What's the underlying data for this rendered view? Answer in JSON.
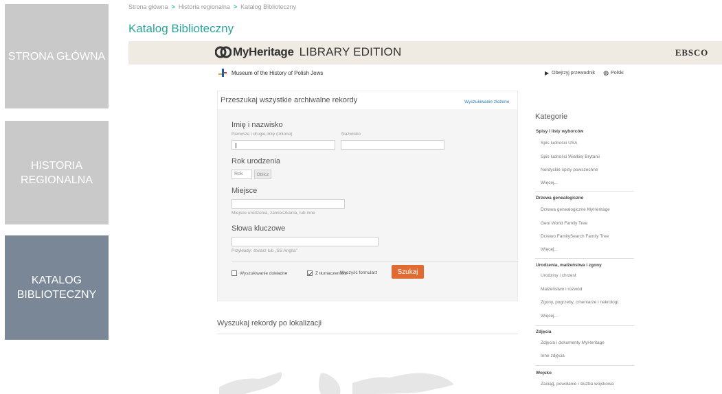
{
  "nav": {
    "tiles": [
      {
        "label": "STRONA GŁÓWNA"
      },
      {
        "label": "HISTORIA REGIONALNA"
      },
      {
        "label": "KATALOG BIBLIOTECZNY"
      }
    ],
    "colors": {
      "inactive": "#c9c9c9",
      "active": "#7a8797"
    }
  },
  "breadcrumb": {
    "items": [
      "Strona główna",
      "Historia regionalna",
      "Katalog Biblioteczny"
    ],
    "separator": ">"
  },
  "page_title": "Katalog Biblioteczny",
  "frame": {
    "brand": "MyHeritage",
    "edition": "LIBRARY EDITION",
    "partner": "EBSCO",
    "institution": "Museum of the History of Polish Jews",
    "guide_link": "Obejrzyj przewodnik",
    "language": "Polski",
    "icons": {
      "guide": "play-icon",
      "language": "globe-icon",
      "logo": "myheritage-logo-icon"
    }
  },
  "search": {
    "title": "Przeszukaj wszystkie archiwalne rekordy",
    "advanced_link": "Wyszukiwanie złożone",
    "name_section": "Imię i nazwisko",
    "first_name_label": "Pierwsze i drugie imię (imiona)",
    "last_name_label": "Nazwisko",
    "first_name_value": "",
    "last_name_value": "",
    "birth_section": "Rok urodzenia",
    "year_placeholder": "Rok",
    "calc_button": "Oblicz",
    "place_section": "Miejsce",
    "place_hint": "Miejsce urodzenia, zamieszkania, lub inne",
    "keywords_section": "Słowa kluczowe",
    "keywords_hint": "Przykłady: stolarz lub „SS Anglia”",
    "exact_label": "Wyszukiwanie dokładne",
    "exact_checked": false,
    "translation_label": "Z tłumaczeniem",
    "translation_checked": true,
    "clear_link": "Wyczyść formularz",
    "submit_button": "Szukaj",
    "accent_color": "#e06b32"
  },
  "location": {
    "title": "Wyszukaj rekordy po lokalizacji"
  },
  "categories": {
    "title": "Kategorie",
    "groups": [
      {
        "heading": "Spisy i listy wyborców",
        "items": [
          "Spis ludności USA",
          "Spis ludności Wielkiej Brytanii",
          "Nordyckie spisy powszechne",
          "Więcej..."
        ]
      },
      {
        "heading": "Drzewa genealogiczne",
        "items": [
          "Drzewa genealogiczne MyHeritage",
          "Geni World Family Tree",
          "Drzewo FamilySearch Family Tree",
          "Więcej..."
        ]
      },
      {
        "heading": "Urodzenia, małżeństwa i zgony",
        "items": [
          "Urodziny i chrzest",
          "Małżeństwo i rozwód",
          "Zgony, pogrzeby, cmentarze i nekrologi",
          "Więcej..."
        ]
      },
      {
        "heading": "Zdjęcia",
        "items": [
          "Zdjęcia i dokumenty MyHeritage",
          "Inne zdjęcia"
        ]
      },
      {
        "heading": "Wojsko",
        "items": [
          "Zaciąg, powołanie i służba wojskowa"
        ]
      }
    ]
  }
}
